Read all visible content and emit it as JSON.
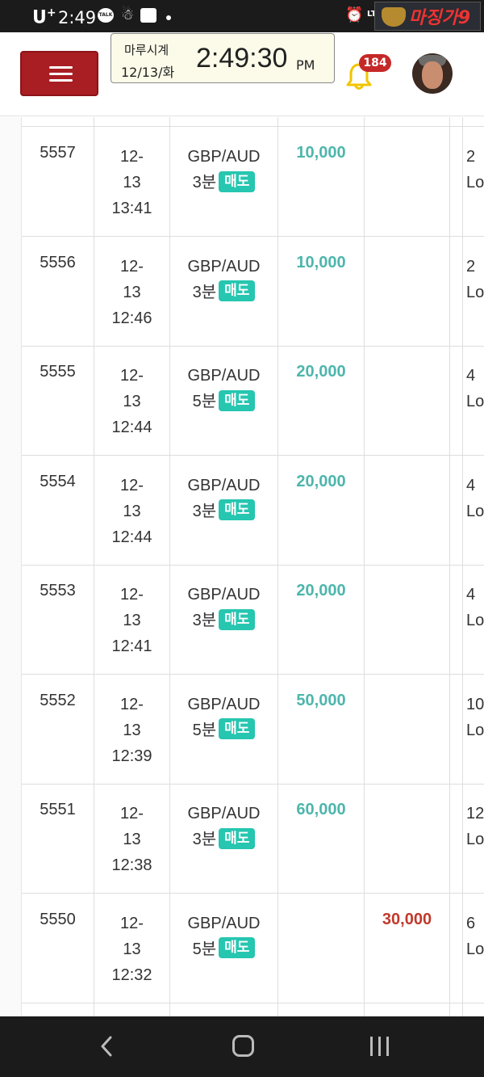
{
  "status_bar": {
    "carrier": "U",
    "carrier_sup": "+",
    "time": "2:49",
    "talk_label": "TALK",
    "network": "LTE",
    "logo_text": "마징가9"
  },
  "header": {
    "clock_title": "마루시계",
    "clock_date": "12/13/화",
    "clock_time": "2:49:30",
    "clock_ampm": "PM",
    "notification_count": "184"
  },
  "trades": [
    {
      "id": "5557",
      "date_line1": "12-",
      "date_line2": "13",
      "time": "13:41",
      "pair": "GBP/AUD",
      "duration": "3분",
      "side": "매도",
      "buy_amount": "10,000",
      "sell_amount": "",
      "amount_partial": "2",
      "result_partial": "Lo"
    },
    {
      "id": "5556",
      "date_line1": "12-",
      "date_line2": "13",
      "time": "12:46",
      "pair": "GBP/AUD",
      "duration": "3분",
      "side": "매도",
      "buy_amount": "10,000",
      "sell_amount": "",
      "amount_partial": "2",
      "result_partial": "Lo"
    },
    {
      "id": "5555",
      "date_line1": "12-",
      "date_line2": "13",
      "time": "12:44",
      "pair": "GBP/AUD",
      "duration": "5분",
      "side": "매도",
      "buy_amount": "20,000",
      "sell_amount": "",
      "amount_partial": "4",
      "result_partial": "Lo"
    },
    {
      "id": "5554",
      "date_line1": "12-",
      "date_line2": "13",
      "time": "12:44",
      "pair": "GBP/AUD",
      "duration": "3분",
      "side": "매도",
      "buy_amount": "20,000",
      "sell_amount": "",
      "amount_partial": "4",
      "result_partial": "Lo"
    },
    {
      "id": "5553",
      "date_line1": "12-",
      "date_line2": "13",
      "time": "12:41",
      "pair": "GBP/AUD",
      "duration": "3분",
      "side": "매도",
      "buy_amount": "20,000",
      "sell_amount": "",
      "amount_partial": "4",
      "result_partial": "Lo"
    },
    {
      "id": "5552",
      "date_line1": "12-",
      "date_line2": "13",
      "time": "12:39",
      "pair": "GBP/AUD",
      "duration": "5분",
      "side": "매도",
      "buy_amount": "50,000",
      "sell_amount": "",
      "amount_partial": "10",
      "result_partial": "Lo"
    },
    {
      "id": "5551",
      "date_line1": "12-",
      "date_line2": "13",
      "time": "12:38",
      "pair": "GBP/AUD",
      "duration": "3분",
      "side": "매도",
      "buy_amount": "60,000",
      "sell_amount": "",
      "amount_partial": "12",
      "result_partial": "Lo"
    },
    {
      "id": "5550",
      "date_line1": "12-",
      "date_line2": "13",
      "time": "12:32",
      "pair": "GBP/AUD",
      "duration": "5분",
      "side": "매도",
      "buy_amount": "",
      "sell_amount": "30,000",
      "amount_partial": "6",
      "result_partial": "Lo"
    }
  ],
  "colors": {
    "menu_button": "#a81e22",
    "buy_text": "#4db6ac",
    "sell_text": "#c0392b",
    "side_tag": "#26c6b0",
    "badge": "#c62828",
    "bell": "#f2c400"
  },
  "icons": {
    "menu": "hamburger-icon",
    "notifications": "bell-icon",
    "nav_back": "chevron-left-icon",
    "nav_home": "home-icon",
    "nav_recent": "recent-apps-icon"
  }
}
